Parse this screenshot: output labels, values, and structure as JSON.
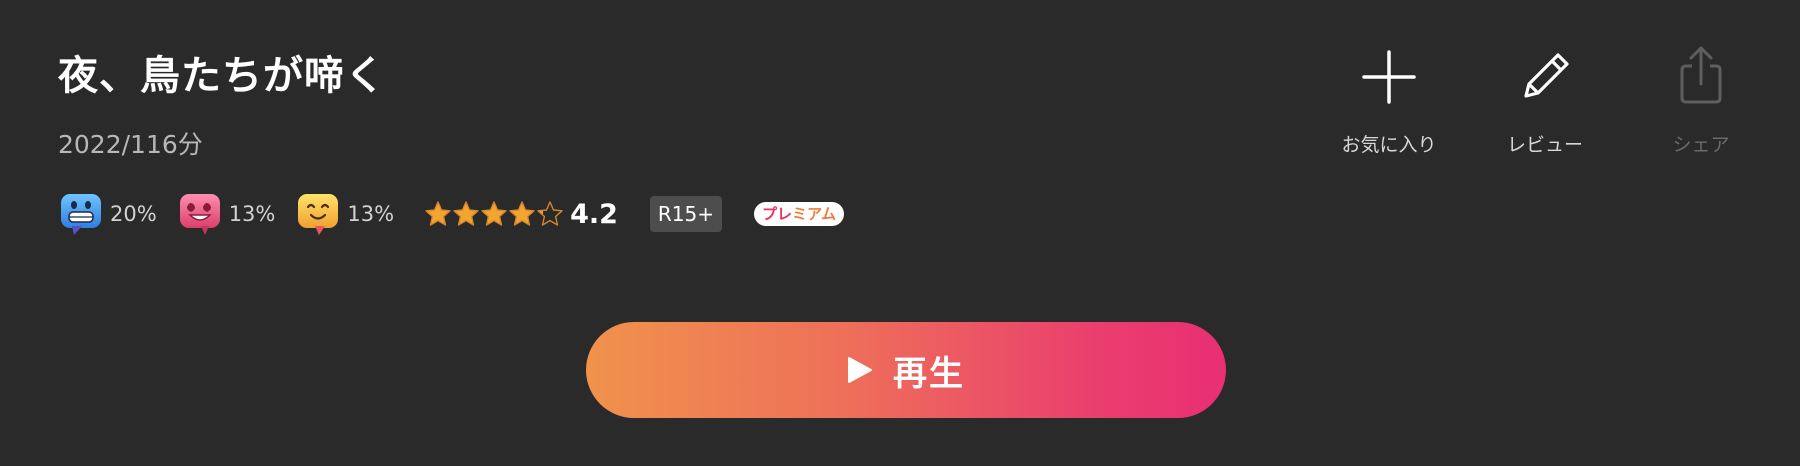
{
  "title": "夜、鳥たちが啼く",
  "meta": "2022/116分",
  "reactions": [
    {
      "icon": "laughing-face-bubble-icon",
      "color": "#4aa8f0",
      "percent": "20%"
    },
    {
      "icon": "love-face-bubble-icon",
      "color": "#e85c86",
      "percent": "13%"
    },
    {
      "icon": "smiling-face-bubble-icon",
      "color": "#f2b13a",
      "percent": "13%"
    }
  ],
  "rating": {
    "value": "4.2",
    "stars_filled": 4.2,
    "stars_total": 5
  },
  "age_rating": "R15+",
  "premium_label": "プレミアム",
  "actions": {
    "favorite": {
      "label": "お気に入り",
      "icon": "plus-icon"
    },
    "review": {
      "label": "レビュー",
      "icon": "pencil-icon"
    },
    "share": {
      "label": "シェア",
      "icon": "share-icon",
      "disabled": true
    }
  },
  "play": {
    "label": "再生",
    "icon": "play-icon"
  },
  "colors": {
    "background": "#2a2a2a",
    "play_gradient_start": "#f0924c",
    "play_gradient_end": "#e82f73",
    "star": "#f2a531"
  }
}
